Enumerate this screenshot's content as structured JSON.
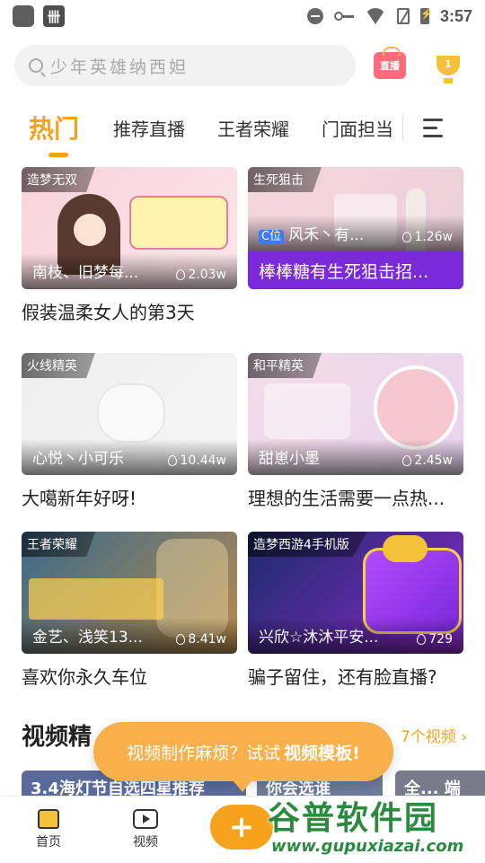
{
  "status_bar": {
    "time": "3:57"
  },
  "search": {
    "placeholder": "少年英雄纳西妲"
  },
  "header": {
    "live_label": "直播",
    "rank_label": "1"
  },
  "tabs": [
    "热门",
    "推荐直播",
    "王者荣耀",
    "门面担当"
  ],
  "cards": [
    {
      "tag": "造梦无双",
      "streamer": "南枝、旧梦每...",
      "hot": "2.03w",
      "title": "假装温柔女人的第3天",
      "thumb_colors": [
        "#f9d2dc",
        "#fbe6ec"
      ]
    },
    {
      "tag": "生死狙击",
      "badge": "C位",
      "streamer": "风禾丶有...",
      "hot": "1.26w",
      "title": "棒棒糖有生死狙击招...",
      "thumb_colors": [
        "#f5d6df",
        "#eacfd8"
      ]
    },
    {
      "tag": "火线精英",
      "streamer": "心悦丶小可乐",
      "hot": "10.44w",
      "title": "大噶新年好呀!",
      "thumb_colors": [
        "#eeeeee",
        "#f6f6f6"
      ]
    },
    {
      "tag": "和平精英",
      "streamer": "甜崽小墨",
      "hot": "2.45w",
      "title": "理想的生活需要一点热...",
      "thumb_colors": [
        "#f4dde7",
        "#e8d3ef"
      ]
    },
    {
      "tag": "王者荣耀",
      "streamer": "金艺、浅笑13...",
      "hot": "8.41w",
      "title": "喜欢你永久车位",
      "thumb_colors": [
        "#3b6a8a",
        "#b98a4c"
      ]
    },
    {
      "tag": "造梦西游4手机版",
      "streamer": "兴欣☆沐沐平安...",
      "hot": "729",
      "title": "骗子留住，还有脸直播?",
      "thumb_colors": [
        "#1b2b6a",
        "#8a2ac8"
      ]
    }
  ],
  "section": {
    "title": "视频精",
    "more": "7个视频"
  },
  "toast": {
    "text": "视频制作麻烦？试试",
    "highlight": "视频模板!"
  },
  "video_strip": [
    "3.4海灯节自选四星推荐",
    "你会选谁",
    "全... 端"
  ],
  "nav": {
    "home": "首页",
    "video": "视频",
    "plus": "+"
  },
  "watermark": {
    "main": "谷普软件园",
    "sub": "www.gupuxiazai.com"
  }
}
